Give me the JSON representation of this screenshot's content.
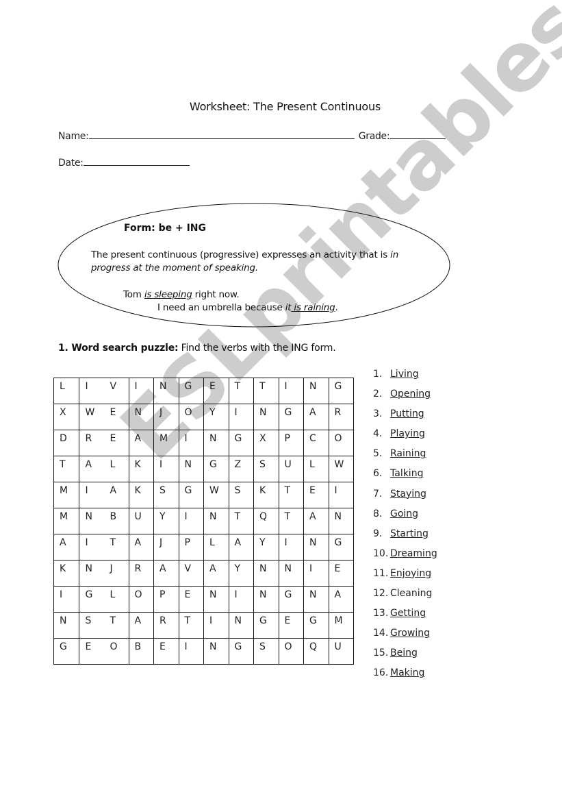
{
  "title": "Worksheet: The Present Continuous",
  "fields": {
    "name_label": "Name:",
    "grade_label": "Grade:",
    "date_label": "Date:"
  },
  "form_box": {
    "form_label": "Form: be + ING",
    "description_plain": "The present continuous (progressive) expresses an activity that is ",
    "description_italic_1": "in",
    "description_italic_2": "progress at the moment of speaking.",
    "example_1_pre": "Tom ",
    "example_1_highlight": "is sleeping",
    "example_1_post": " right now.",
    "example_2_pre": "I need an umbrella because ",
    "example_2_italic": "it",
    "example_2_highlight": " is raining",
    "example_2_post": "."
  },
  "section": {
    "number_title": "1. Word search puzzle:",
    "instruction": " Find the verbs with the ING form."
  },
  "grid": [
    [
      "L",
      "I",
      "V",
      "I",
      "N",
      "G",
      "E",
      "T",
      "T",
      "I",
      "N",
      "G"
    ],
    [
      "X",
      "W",
      "E",
      "N",
      "J",
      "O",
      "Y",
      "I",
      "N",
      "G",
      "A",
      "R"
    ],
    [
      "D",
      "R",
      "E",
      "A",
      "M",
      "I",
      "N",
      "G",
      "X",
      "P",
      "C",
      "O"
    ],
    [
      "T",
      "A",
      "L",
      "K",
      "I",
      "N",
      "G",
      "Z",
      "S",
      "U",
      "L",
      "W"
    ],
    [
      "M",
      "I",
      "A",
      "K",
      "S",
      "G",
      "W",
      "S",
      "K",
      "T",
      "E",
      "I"
    ],
    [
      "M",
      "N",
      "B",
      "U",
      "Y",
      "I",
      "N",
      "T",
      "Q",
      "T",
      "A",
      "N"
    ],
    [
      "A",
      "I",
      "T",
      "A",
      "J",
      "P",
      "L",
      "A",
      "Y",
      "I",
      "N",
      "G"
    ],
    [
      "K",
      "N",
      "J",
      "R",
      "A",
      "V",
      "A",
      "Y",
      "N",
      "N",
      "I",
      "E"
    ],
    [
      "I",
      "G",
      "L",
      "O",
      "P",
      "E",
      "N",
      "I",
      "N",
      "G",
      "N",
      "A"
    ],
    [
      "N",
      "S",
      "T",
      "A",
      "R",
      "T",
      "I",
      "N",
      "G",
      "E",
      "G",
      "M"
    ],
    [
      "G",
      "E",
      "O",
      "B",
      "E",
      "I",
      "N",
      "G",
      "S",
      "O",
      "Q",
      "U"
    ]
  ],
  "word_list": [
    {
      "num": "1.",
      "word": "Living",
      "underlined": true
    },
    {
      "num": "2.",
      "word": "Opening",
      "underlined": true
    },
    {
      "num": "3.",
      "word": "Putting",
      "underlined": true
    },
    {
      "num": "4.",
      "word": "Playing",
      "underlined": true
    },
    {
      "num": "5.",
      "word": "Raining",
      "underlined": true
    },
    {
      "num": "6.",
      "word": "Talking",
      "underlined": true
    },
    {
      "num": "7.",
      "word": "Staying",
      "underlined": true
    },
    {
      "num": "8.",
      "word": "Going",
      "underlined": true
    },
    {
      "num": "9.",
      "word": "Starting",
      "underlined": true
    },
    {
      "num": "10.",
      "word": "Dreaming",
      "underlined": true
    },
    {
      "num": "11.",
      "word": "Enjoying",
      "underlined": true
    },
    {
      "num": "12.",
      "word": "Cleaning",
      "underlined": false
    },
    {
      "num": "13.",
      "word": "Getting",
      "underlined": true
    },
    {
      "num": "14.",
      "word": "Growing",
      "underlined": true
    },
    {
      "num": "15.",
      "word": "Being",
      "underlined": true
    },
    {
      "num": "16.",
      "word": "Making",
      "underlined": true
    }
  ],
  "watermark": "ESLprintables.com",
  "colors": {
    "watermark": "#c8c8c8",
    "text": "#111111",
    "border": "#111111"
  }
}
